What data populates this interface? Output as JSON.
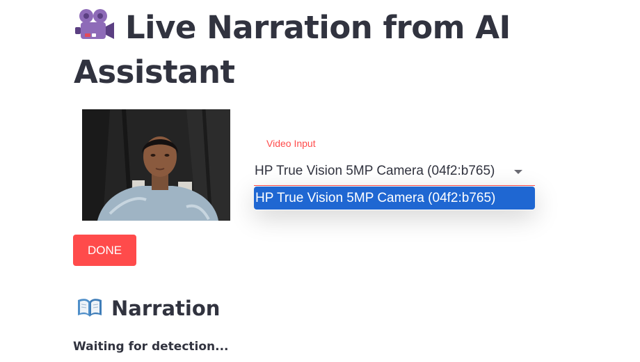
{
  "header": {
    "title": "Live Narration from AI Assistant",
    "title_icon": "movie-camera-icon"
  },
  "video": {
    "description_icon": "webcam-feed"
  },
  "video_input": {
    "label": "Video Input",
    "selected_value": "HP True Vision 5MP Camera (04f2:b765)",
    "options": [
      "HP True Vision 5MP Camera (04f2:b765)"
    ],
    "accent_color": "#ff4b4b",
    "highlight_color": "#1f67d2"
  },
  "controls": {
    "done_label": "DONE",
    "done_color": "#ff4b4b"
  },
  "narration": {
    "heading": "Narration",
    "heading_icon": "open-book-icon",
    "status": "Waiting for detection..."
  }
}
